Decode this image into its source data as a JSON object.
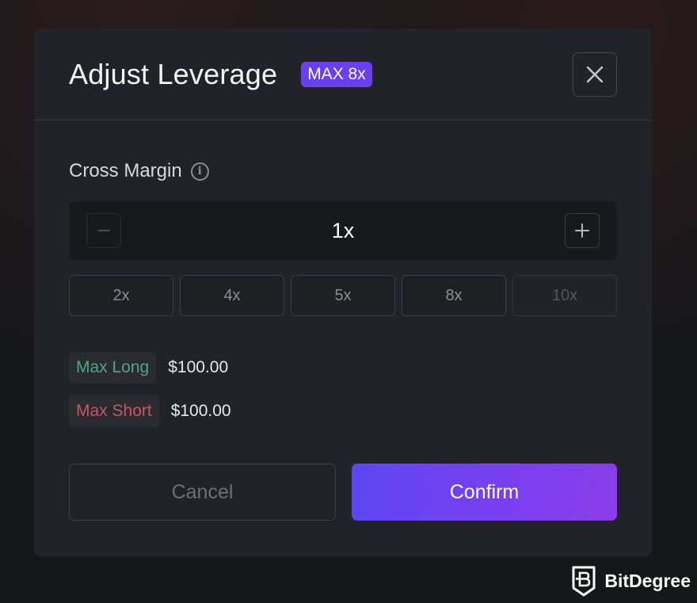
{
  "modal": {
    "title": "Adjust Leverage",
    "max_badge": "MAX 8x",
    "close_icon": "close-icon"
  },
  "margin": {
    "label": "Cross Margin",
    "info_icon": "info-icon"
  },
  "stepper": {
    "value": "1x",
    "decrement_icon": "minus-icon",
    "increment_icon": "plus-icon",
    "decrement_disabled": true
  },
  "presets": [
    {
      "label": "2x",
      "disabled": false
    },
    {
      "label": "4x",
      "disabled": false
    },
    {
      "label": "5x",
      "disabled": false
    },
    {
      "label": "8x",
      "disabled": false
    },
    {
      "label": "10x",
      "disabled": true
    }
  ],
  "limits": {
    "max_long_label": "Max Long",
    "max_long_value": "$100.00",
    "max_short_label": "Max Short",
    "max_short_value": "$100.00",
    "long_color": "#4fa685",
    "short_color": "#c85669"
  },
  "actions": {
    "cancel_label": "Cancel",
    "confirm_label": "Confirm"
  },
  "colors": {
    "accent": "#6a3ff0",
    "modal_bg": "#222328"
  },
  "watermark": {
    "name": "BitDegree",
    "icon": "bitdegree-shield-icon"
  }
}
